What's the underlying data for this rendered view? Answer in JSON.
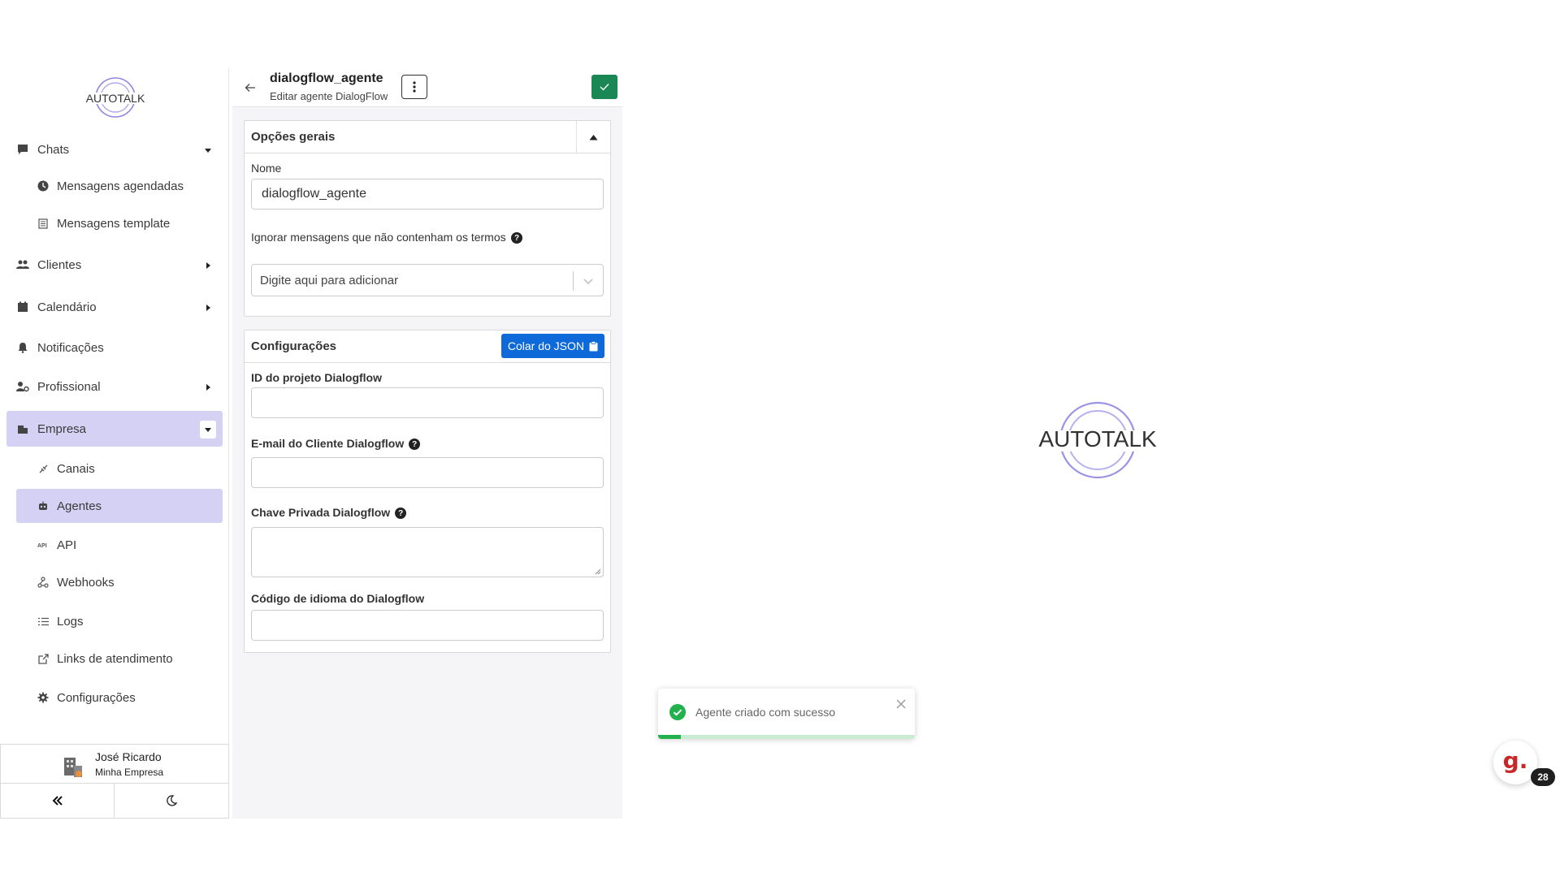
{
  "brand": {
    "logo_text": "AUTOTALK",
    "accent": "#d4d1f5",
    "logo_ring_color": "#7b74d9"
  },
  "sidebar": {
    "items": [
      {
        "label": "Chats",
        "icon": "comment-icon",
        "has_caret": true,
        "caret": "down"
      },
      {
        "label": "Mensagens agendadas",
        "icon": "clock-icon",
        "sub": true
      },
      {
        "label": "Mensagens template",
        "icon": "template-icon",
        "sub": true
      },
      {
        "label": "Clientes",
        "icon": "users-icon",
        "has_caret": true,
        "caret": "right"
      },
      {
        "label": "Calendário",
        "icon": "calendar-icon",
        "has_caret": true,
        "caret": "right"
      },
      {
        "label": "Notificações",
        "icon": "bell-icon"
      },
      {
        "label": "Profissional",
        "icon": "user-gear-icon",
        "has_caret": true,
        "caret": "right"
      },
      {
        "label": "Empresa",
        "icon": "building-icon",
        "has_caret": true,
        "caret": "down",
        "active": true
      },
      {
        "label": "Canais",
        "icon": "plug-icon",
        "sub": true
      },
      {
        "label": "Agentes",
        "icon": "robot-icon",
        "sub": true,
        "active": true
      },
      {
        "label": "API",
        "icon": "api-icon",
        "sub": true
      },
      {
        "label": "Webhooks",
        "icon": "webhook-icon",
        "sub": true
      },
      {
        "label": "Logs",
        "icon": "list-icon",
        "sub": true
      },
      {
        "label": "Links de atendimento",
        "icon": "external-link-icon",
        "sub": true
      },
      {
        "label": "Configurações",
        "icon": "gear-icon",
        "sub": true
      }
    ],
    "user": {
      "name": "José Ricardo",
      "company": "Minha Empresa"
    }
  },
  "editor": {
    "title": "dialogflow_agente",
    "subtitle": "Editar agente DialogFlow",
    "save_color": "#1a8754",
    "general": {
      "title": "Opções gerais",
      "name_label": "Nome",
      "name_value": "dialogflow_agente",
      "ignore_label": "Ignorar mensagens que não contenham os termos",
      "ignore_placeholder": "Digite aqui para adicionar"
    },
    "config": {
      "title": "Configurações",
      "json_button": "Colar do JSON",
      "json_button_color": "#0d6ad8",
      "project_id_label": "ID do projeto Dialogflow",
      "project_id_value": "",
      "email_label": "E-mail do Cliente Dialogflow",
      "email_value": "",
      "key_label": "Chave Privada Dialogflow",
      "key_value": "",
      "lang_label": "Código de idioma do Dialogflow",
      "lang_value": ""
    }
  },
  "toast": {
    "message": "Agente criado com sucesso",
    "status_color": "#22b14c",
    "progress": 0.09
  },
  "widget": {
    "letter": "g.",
    "badge": "28"
  }
}
